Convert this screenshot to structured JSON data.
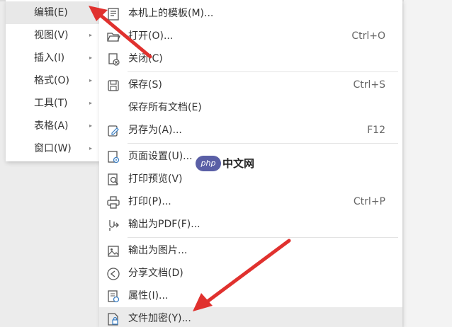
{
  "main_menu": {
    "items": [
      {
        "label": "编辑(E)",
        "has_submenu": false,
        "highlighted": true
      },
      {
        "label": "视图(V)",
        "has_submenu": true,
        "highlighted": false
      },
      {
        "label": "插入(I)",
        "has_submenu": true,
        "highlighted": false
      },
      {
        "label": "格式(O)",
        "has_submenu": true,
        "highlighted": false
      },
      {
        "label": "工具(T)",
        "has_submenu": true,
        "highlighted": false
      },
      {
        "label": "表格(A)",
        "has_submenu": true,
        "highlighted": false
      },
      {
        "label": "窗口(W)",
        "has_submenu": true,
        "highlighted": false
      }
    ],
    "arrow_glyph": "▸"
  },
  "file_menu": {
    "items": [
      {
        "label": "本机上的模板(M)...",
        "shortcut": "",
        "icon": "template-icon"
      },
      {
        "label": "打开(O)...",
        "shortcut": "Ctrl+O",
        "icon": "folder-open-icon"
      },
      {
        "label": "关闭(C)",
        "shortcut": "",
        "icon": "close-doc-icon"
      },
      {
        "label": "保存(S)",
        "shortcut": "Ctrl+S",
        "icon": "save-icon"
      },
      {
        "label": "保存所有文档(E)",
        "shortcut": "",
        "icon": ""
      },
      {
        "label": "另存为(A)...",
        "shortcut": "F12",
        "icon": "save-as-icon"
      },
      {
        "label": "页面设置(U)...",
        "shortcut": "",
        "icon": "page-setup-icon"
      },
      {
        "label": "打印预览(V)",
        "shortcut": "",
        "icon": "print-preview-icon"
      },
      {
        "label": "打印(P)...",
        "shortcut": "Ctrl+P",
        "icon": "printer-icon"
      },
      {
        "label": "输出为PDF(F)...",
        "shortcut": "",
        "icon": "export-pdf-icon"
      },
      {
        "label": "输出为图片...",
        "shortcut": "",
        "icon": "export-image-icon"
      },
      {
        "label": "分享文档(D)",
        "shortcut": "",
        "icon": "share-icon"
      },
      {
        "label": "属性(I)...",
        "shortcut": "",
        "icon": "properties-icon"
      },
      {
        "label": "文件加密(Y)...",
        "shortcut": "",
        "icon": "file-encrypt-icon"
      }
    ]
  },
  "watermark": {
    "logo_text": "php",
    "text": "中文网"
  },
  "colors": {
    "arrow": "#e0312e",
    "highlight": "#e8e8e8",
    "menu_bg": "#ffffff"
  }
}
